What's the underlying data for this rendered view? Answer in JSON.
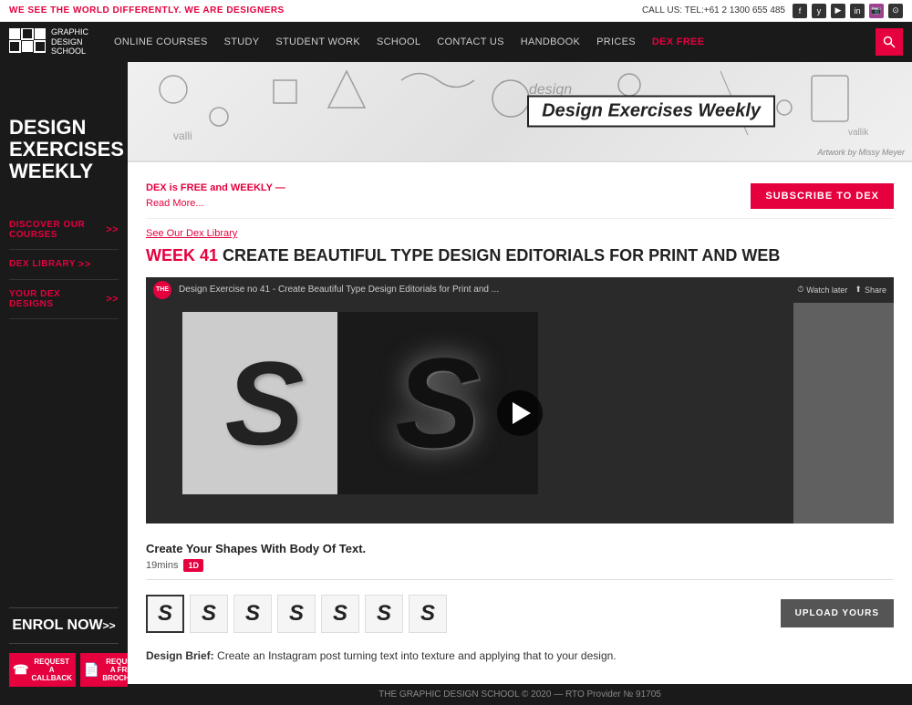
{
  "topbar": {
    "tagline": "WE SEE THE WORLD DIFFERENTLY. WE ARE DESIGNERS",
    "phone": "CALL US: TEL:+61 2 1300 655 485",
    "social": [
      "f",
      "y",
      "▶",
      "in",
      "📷",
      "⊙"
    ]
  },
  "nav": {
    "logo_text1": "GRAPHIC",
    "logo_text2": "DESIGN",
    "logo_text3": "SCHOOL",
    "links": [
      "ONLINE COURSES",
      "STUDY",
      "STUDENT WORK",
      "SCHOOL",
      "CONTACT US",
      "HANDBOOK",
      "PRICES",
      "DEX FREE"
    ]
  },
  "sidebar": {
    "heading": "DESIGN\nEXERCISES\nWEEKLY",
    "nav_items": [
      {
        "label": "DISCOVER OUR COURSES",
        "chevrons": ">>"
      },
      {
        "label": "DEX LIBRARY",
        "chevrons": ">>"
      },
      {
        "label": "YOUR DEX DESIGNS",
        "chevrons": ">>"
      }
    ],
    "enrol_label": "ENROL NOW",
    "enrol_chevrons": ">>",
    "action1_label": "REQUEST A CALLBACK",
    "action2_label": "REQUEST A FREE BROCHURE"
  },
  "hero": {
    "title": "Design Exercises Weekly",
    "artwork_credit": "Artwork by Missy Meyer"
  },
  "content": {
    "dex_free_text1": "DEX is FREE and WEEKLY —",
    "dex_free_text2": "Read More...",
    "subscribe_label": "SUBSCRIBE TO DEX",
    "see_library": "See Our Dex Library",
    "week_number": "WEEK 41",
    "week_title": "CREATE BEAUTIFUL TYPE DESIGN EDITORIALS FOR PRINT AND WEB",
    "video_title": "Design Exercise no 41 - Create Beautiful Type Design Editorials for Print and ...",
    "watch_later": "Watch later",
    "share": "Share",
    "desc_title": "Create Your Shapes With Body Of Text.",
    "duration": "19mins",
    "thumbnail_letters": [
      "S",
      "S",
      "S",
      "S",
      "S",
      "S",
      "S"
    ],
    "upload_btn": "UPLOAD YOURS",
    "design_brief_label": "Design Brief:",
    "design_brief_text": "Create an Instagram post turning text into texture and applying that to your design."
  },
  "footer": {
    "text": "THE GRAPHIC DESIGN SCHOOL © 2020 — RTO Provider № 91705"
  }
}
